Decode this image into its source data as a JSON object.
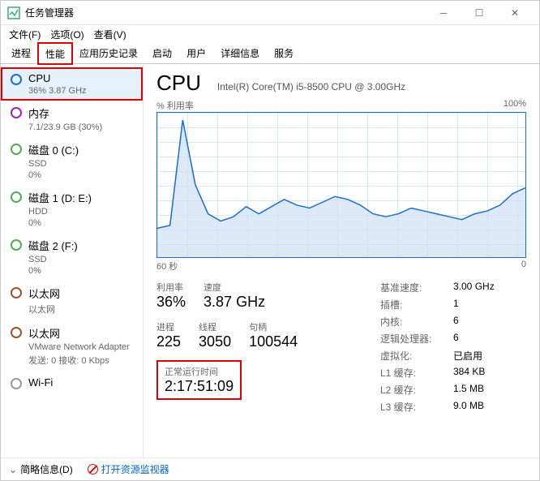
{
  "window": {
    "title": "任务管理器"
  },
  "menu": {
    "file": "文件(F)",
    "options": "选项(O)",
    "view": "查看(V)"
  },
  "tabs": {
    "processes": "进程",
    "performance": "性能",
    "history": "应用历史记录",
    "startup": "启动",
    "users": "用户",
    "details": "详细信息",
    "services": "服务"
  },
  "sidebar": {
    "cpu": {
      "name": "CPU",
      "sub": "36% 3.87 GHz"
    },
    "memory": {
      "name": "内存",
      "sub": "7.1/23.9 GB (30%)"
    },
    "disk0": {
      "name": "磁盘 0 (C:)",
      "sub1": "SSD",
      "sub2": "0%"
    },
    "disk1": {
      "name": "磁盘 1 (D: E:)",
      "sub1": "HDD",
      "sub2": "0%"
    },
    "disk2": {
      "name": "磁盘 2 (F:)",
      "sub1": "SSD",
      "sub2": "0%"
    },
    "eth0": {
      "name": "以太网",
      "sub": "以太网"
    },
    "eth1": {
      "name": "以太网",
      "sub1": "VMware Network Adapter",
      "sub2": "发送: 0 接收: 0 Kbps"
    },
    "wifi": {
      "name": "Wi-Fi"
    }
  },
  "detail": {
    "title": "CPU",
    "model": "Intel(R) Core(TM) i5-8500 CPU @ 3.00GHz",
    "chart_ylabel": "% 利用率",
    "chart_ymax": "100%",
    "chart_xlabel_left": "60 秒",
    "chart_xlabel_right": "0",
    "stats": {
      "util_label": "利用率",
      "util": "36%",
      "speed_label": "速度",
      "speed": "3.87 GHz",
      "proc_label": "进程",
      "proc": "225",
      "threads_label": "线程",
      "threads": "3050",
      "handles_label": "句柄",
      "handles": "100544",
      "uptime_label": "正常运行时间",
      "uptime": "2:17:51:09"
    },
    "right": {
      "base_label": "基准速度:",
      "base": "3.00 GHz",
      "sockets_label": "插槽:",
      "sockets": "1",
      "cores_label": "内核:",
      "cores": "6",
      "lp_label": "逻辑处理器:",
      "lp": "6",
      "virt_label": "虚拟化:",
      "virt": "已启用",
      "l1_label": "L1 缓存:",
      "l1": "384 KB",
      "l2_label": "L2 缓存:",
      "l2": "1.5 MB",
      "l3_label": "L3 缓存:",
      "l3": "9.0 MB"
    }
  },
  "statusbar": {
    "fewer": "简略信息(D)",
    "monitor": "打开资源监视器"
  },
  "chart_data": {
    "type": "line",
    "title": "% 利用率",
    "ylabel": "% 利用率",
    "ylim": [
      0,
      100
    ],
    "xlabel": "秒",
    "xlim": [
      60,
      0
    ],
    "values": [
      20,
      22,
      95,
      50,
      30,
      25,
      28,
      35,
      30,
      35,
      40,
      36,
      34,
      38,
      42,
      40,
      36,
      30,
      28,
      30,
      34,
      32,
      30,
      28,
      26,
      30,
      32,
      36,
      44,
      48
    ]
  }
}
